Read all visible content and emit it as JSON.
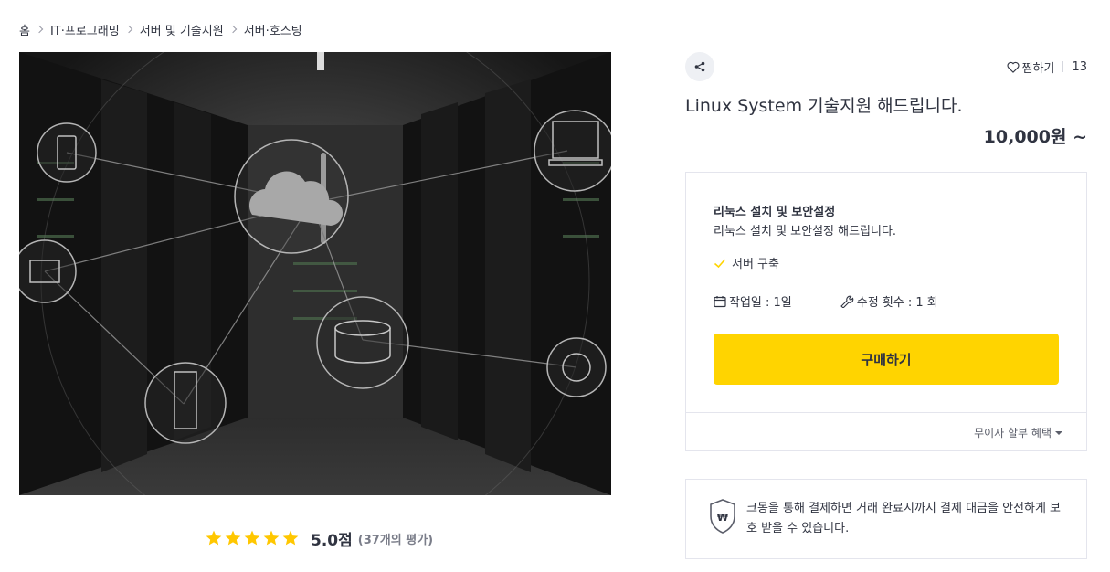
{
  "breadcrumb": [
    "홈",
    "IT·프로그래밍",
    "서버 및 기술지원",
    "서버·호스팅"
  ],
  "hero": {
    "alt": "Server room with network icons"
  },
  "rating": {
    "stars": 5,
    "score_text": "5.0점",
    "count_text": "(37개의 평가)",
    "star_color": "#ffc700"
  },
  "actions": {
    "wishlist_label": "찜하기",
    "wishlist_count": "13"
  },
  "service": {
    "title": "Linux System 기술지원 해드립니다.",
    "price": "10,000원 ~"
  },
  "package": {
    "name": "리눅스 설치 및 보안설정",
    "description": "리눅스 설치 및 보안설정 해드립니다.",
    "feature": "서버 구축",
    "work_days": "작업일 : 1일",
    "revisions": "수정 횟수 : 1 회",
    "buy_label": "구매하기",
    "installment_label": "무이자 할부 혜택",
    "accent_color": "#ffd400"
  },
  "safe_payment": {
    "text": "크몽을 통해 결제하면 거래 완료시까지 결제 대금을 안전하게 보호 받을 수 있습니다."
  },
  "icons": [
    "share-icon",
    "heart-icon",
    "check-icon",
    "calendar-icon",
    "wrench-icon",
    "shield-icon",
    "star-icon",
    "chevron-right-icon"
  ]
}
